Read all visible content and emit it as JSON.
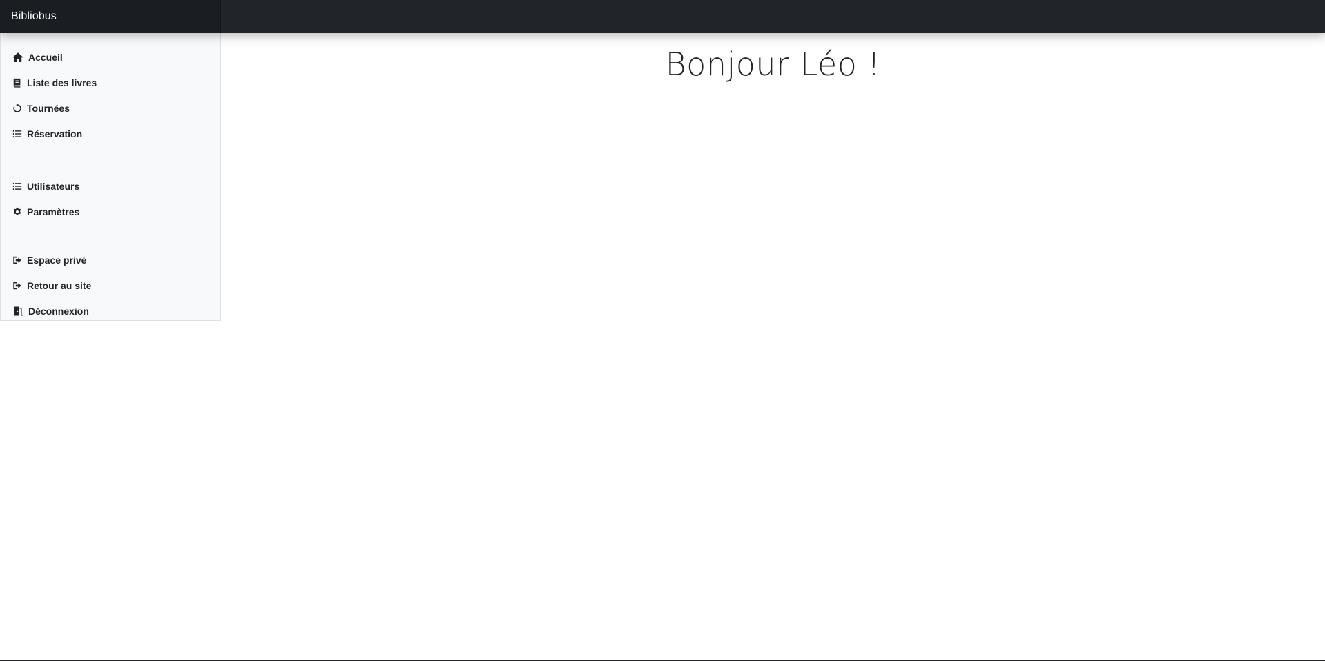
{
  "navbar": {
    "brand": "Bibliobus"
  },
  "sidebar": {
    "groups": [
      {
        "items": [
          {
            "label": "Accueil",
            "icon": "home-icon"
          },
          {
            "label": "Liste des livres",
            "icon": "book-icon"
          },
          {
            "label": "Tournées",
            "icon": "circle-arrow-icon"
          },
          {
            "label": "Réservation",
            "icon": "list-icon"
          }
        ]
      },
      {
        "items": [
          {
            "label": "Utilisateurs",
            "icon": "list-icon"
          },
          {
            "label": "Paramètres",
            "icon": "gear-icon"
          }
        ]
      },
      {
        "items": [
          {
            "label": "Espace privé",
            "icon": "sign-out-icon"
          },
          {
            "label": "Retour au site",
            "icon": "sign-out-icon"
          },
          {
            "label": "Déconnexion",
            "icon": "door-open-icon"
          }
        ]
      }
    ]
  },
  "main": {
    "greeting": "Bonjour Léo !"
  },
  "colors": {
    "navbar_bg": "#212529",
    "sidebar_bg": "#f8f9fa",
    "text": "#212529"
  }
}
